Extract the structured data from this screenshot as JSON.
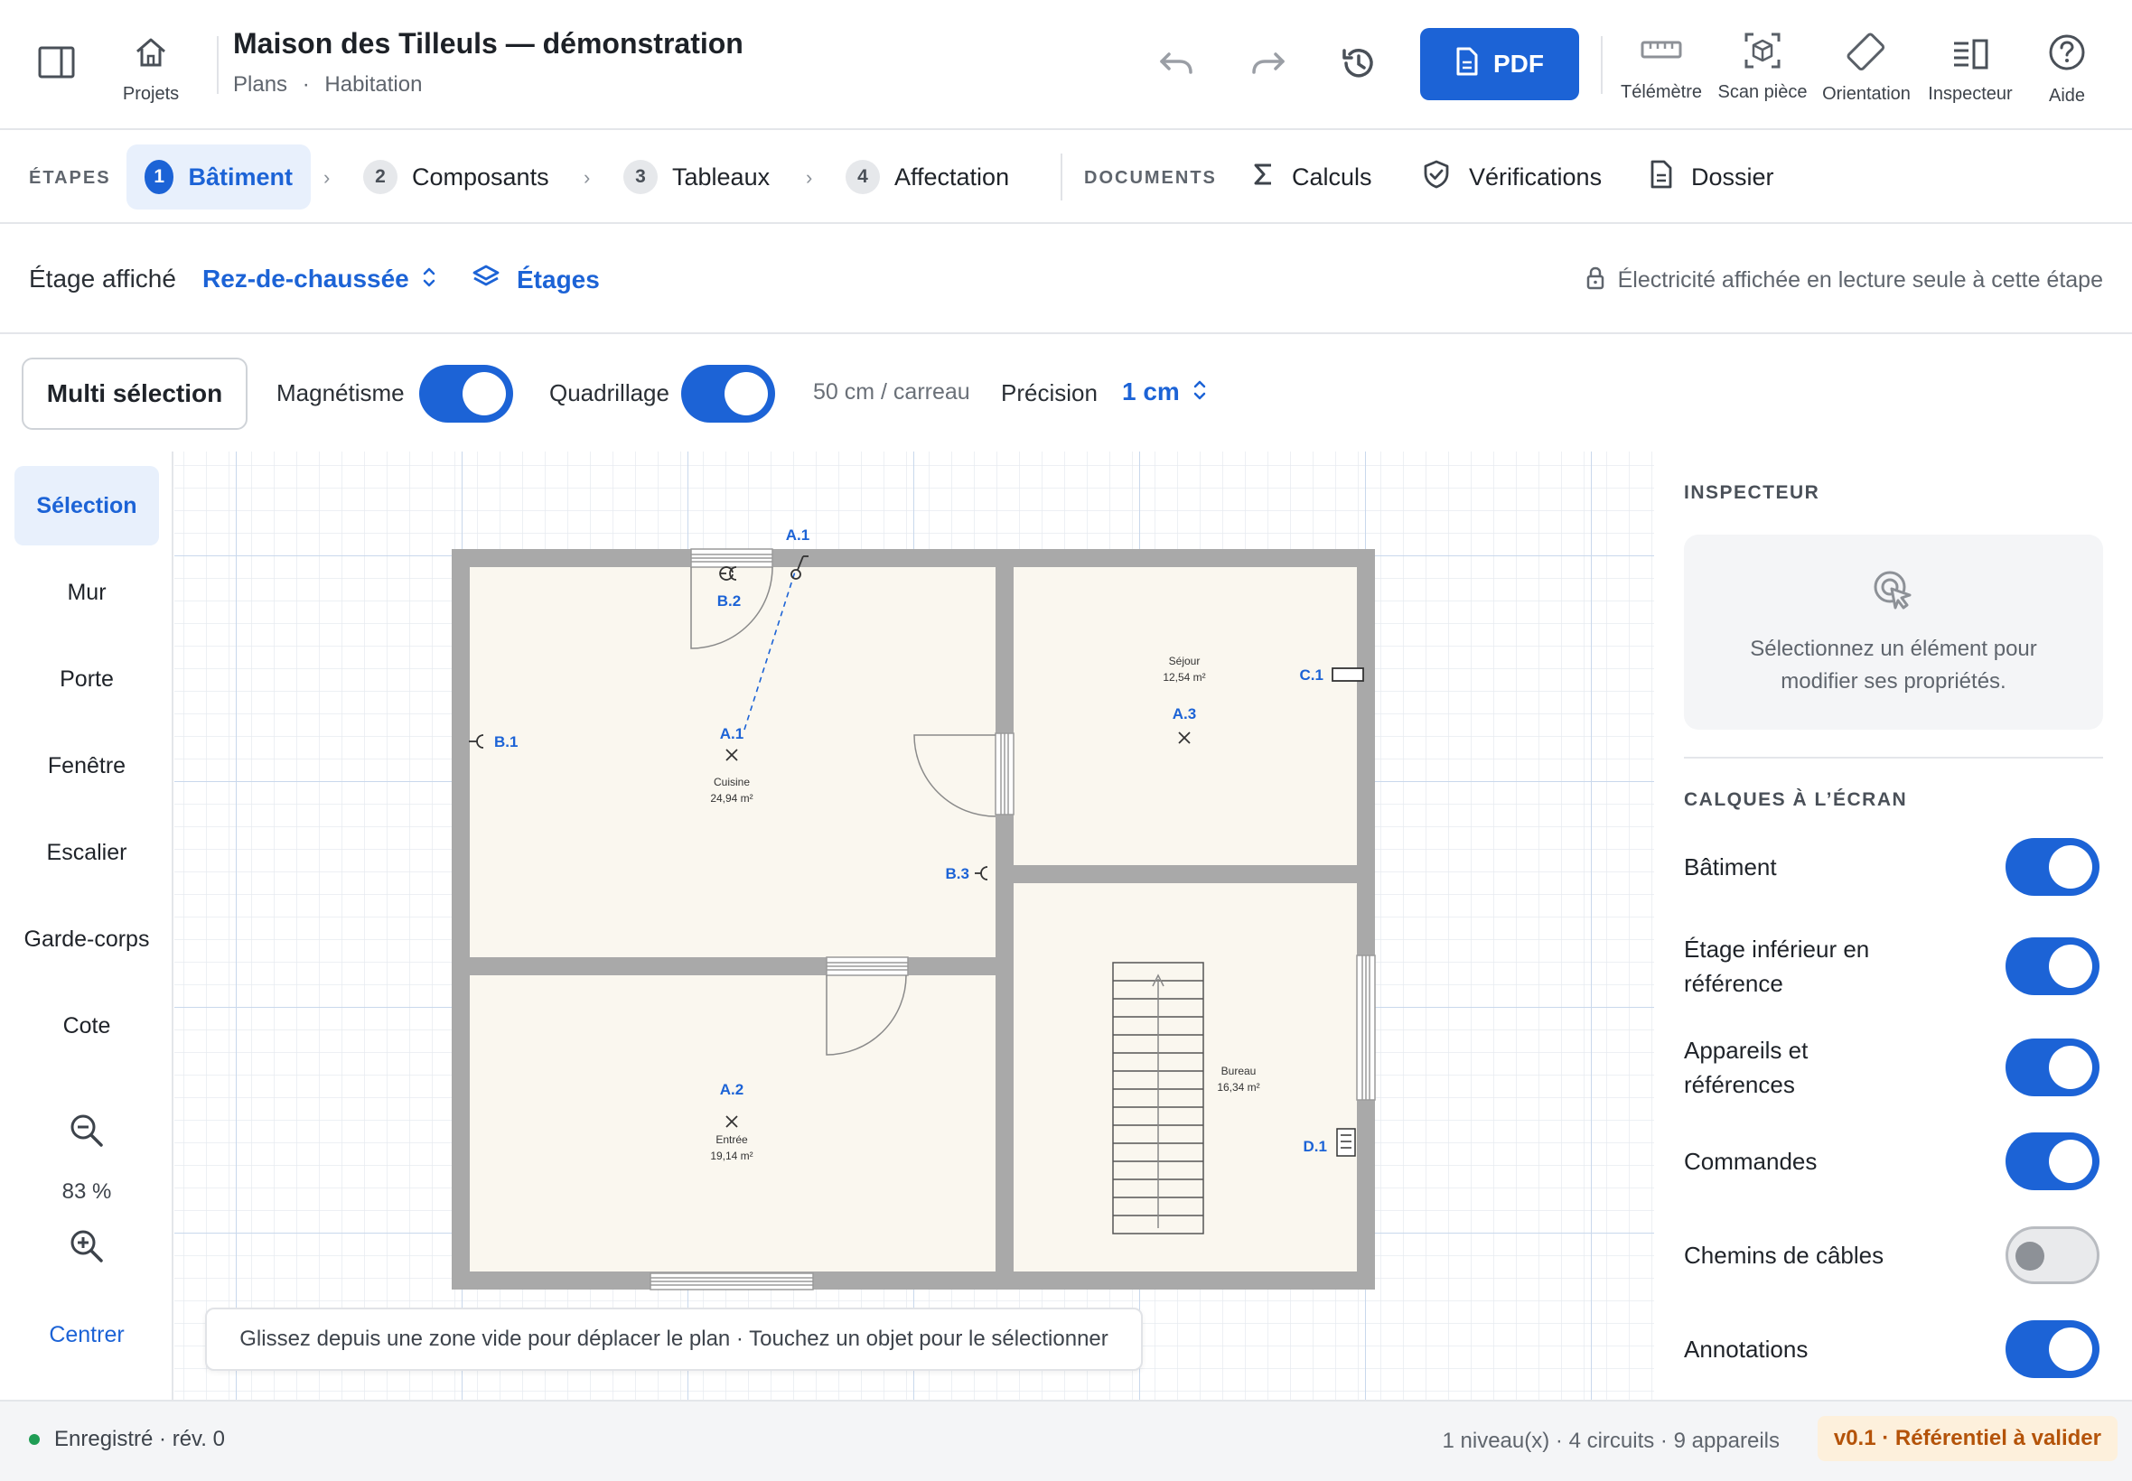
{
  "topbar": {
    "projects_label": "Projets",
    "title": "Maison des Tilleuls — démonstration",
    "breadcrumb": [
      "Plans",
      "Habitation"
    ],
    "breadcrumb_sep": "·",
    "pdf_label": "PDF",
    "tools": [
      {
        "label": "Télémètre",
        "icon": "ruler-icon"
      },
      {
        "label": "Scan pièce",
        "icon": "scan-cube-icon"
      },
      {
        "label": "Orientation",
        "icon": "rotate-device-icon"
      },
      {
        "label": "Inspecteur",
        "icon": "inspector-panel-icon"
      },
      {
        "label": "Aide",
        "icon": "help-icon"
      }
    ]
  },
  "steps": {
    "section_label": "ÉTAPES",
    "items": [
      {
        "num": "1",
        "label": "Bâtiment",
        "active": true
      },
      {
        "num": "2",
        "label": "Composants"
      },
      {
        "num": "3",
        "label": "Tableaux"
      },
      {
        "num": "4",
        "label": "Affectation"
      }
    ],
    "documents_label": "DOCUMENTS",
    "documents": [
      {
        "label": "Calculs",
        "icon": "sigma-icon"
      },
      {
        "label": "Vérifications",
        "icon": "shield-check-icon"
      },
      {
        "label": "Dossier",
        "icon": "document-icon"
      }
    ]
  },
  "floor": {
    "label": "Étage affiché",
    "value": "Rez-de-chaussée",
    "floors_button": "Étages",
    "readonly_notice": "Électricité affichée en lecture seule à cette étape"
  },
  "toolbar": {
    "multi_select": "Multi sélection",
    "magnetism_label": "Magnétisme",
    "magnetism_on": true,
    "grid_label": "Quadrillage",
    "grid_on": true,
    "grid_scale": "50 cm / carreau",
    "precision_label": "Précision",
    "precision_value": "1 cm"
  },
  "tools": {
    "items": [
      "Sélection",
      "Mur",
      "Porte",
      "Fenêtre",
      "Escalier",
      "Garde-corps",
      "Cote"
    ],
    "active": "Sélection",
    "zoom": "83 %",
    "center": "Centrer"
  },
  "plan": {
    "rooms": [
      {
        "name": "Cuisine",
        "area": "24,94 m²"
      },
      {
        "name": "Séjour",
        "area": "12,54 m²"
      },
      {
        "name": "Entrée",
        "area": "19,14 m²"
      },
      {
        "name": "Bureau",
        "area": "16,34 m²"
      }
    ],
    "devices": {
      "a1_top": "A.1",
      "a1": "A.1",
      "a2": "A.2",
      "a3": "A.3",
      "b1": "B.1",
      "b2": "B.2",
      "b3": "B.3",
      "c1": "C.1",
      "d1": "D.1"
    },
    "hint": "Glissez depuis une zone vide pour déplacer le plan · Touchez un objet pour le sélectionner"
  },
  "inspector": {
    "title": "INSPECTEUR",
    "empty_message": "Sélectionnez un élément pour modifier ses propriétés.",
    "layers_title": "CALQUES À L’ÉCRAN",
    "layers": [
      {
        "name": "Bâtiment",
        "on": true
      },
      {
        "name": "Étage inférieur en référence",
        "on": true
      },
      {
        "name": "Appareils et références",
        "on": true
      },
      {
        "name": "Commandes",
        "on": true
      },
      {
        "name": "Chemins de câbles",
        "on": false
      },
      {
        "name": "Annotations",
        "on": true
      }
    ]
  },
  "footer": {
    "status": "Enregistré · rév. 0",
    "status_color": "#1f9d55",
    "summary": "1 niveau(x) · 4 circuits · 9 appareils",
    "version_badge": "v0.1 · Référentiel à valider"
  },
  "colors": {
    "accent": "#1c63d6",
    "wall": "#a9a9a9",
    "room_fill": "#faf7ef",
    "badge_bg": "#fdf0dc",
    "badge_text": "#b45309"
  }
}
